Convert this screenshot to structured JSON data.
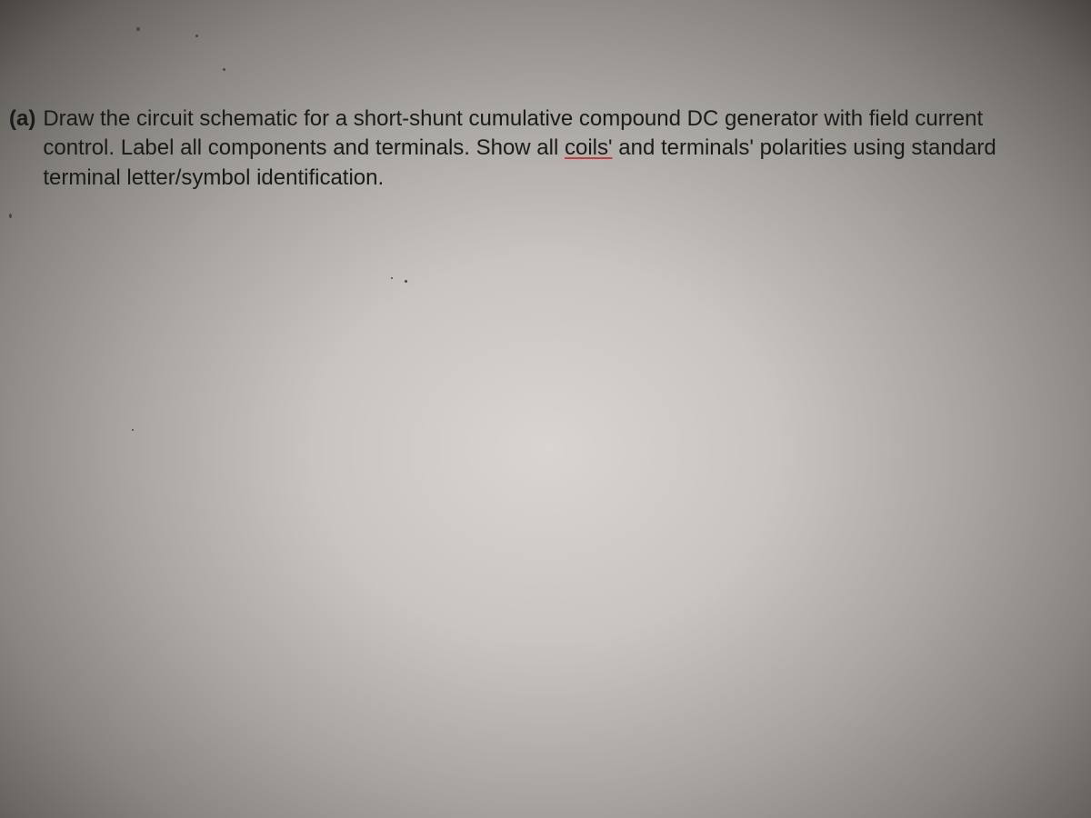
{
  "question": {
    "label": "(a)",
    "text_before_underline": "Draw the circuit schematic for a short-shunt cumulative compound DC generator with field current control. Label all components and terminals. Show all ",
    "underlined_word": "coils'",
    "text_after_underline": " and terminals' polarities using standard terminal letter/symbol identification."
  }
}
